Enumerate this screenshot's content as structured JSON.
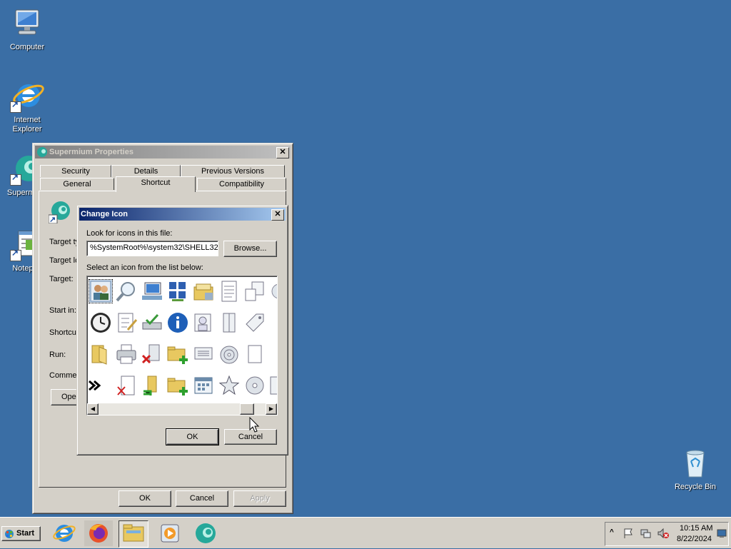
{
  "desktop": {
    "icons": [
      {
        "label": "Computer"
      },
      {
        "label": "Internet Explorer"
      },
      {
        "label": "Supermium"
      },
      {
        "label": "Notepad"
      },
      {
        "label": "Recycle Bin"
      }
    ]
  },
  "properties_dialog": {
    "title": "Supermium Properties",
    "tabs_row1": [
      "Security",
      "Details",
      "Previous Versions"
    ],
    "tabs_row2": [
      "General",
      "Shortcut",
      "Compatibility"
    ],
    "active_tab": "Shortcut",
    "fields": {
      "target_type": "Target ty",
      "target_location": "Target lo",
      "target": "Target:",
      "start_in": "Start in:",
      "shortcut_key": "Shortcut",
      "run": "Run:",
      "comment": "Commen",
      "open_button": "Ope"
    },
    "buttons": {
      "ok": "OK",
      "cancel": "Cancel",
      "apply": "Apply"
    }
  },
  "change_icon_dialog": {
    "title": "Change Icon",
    "look_label": "Look for icons in this file:",
    "file_value": "%SystemRoot%\\system32\\SHELL32",
    "browse_label": "Browse...",
    "select_label": "Select an icon from the list below:",
    "ok_label": "OK",
    "cancel_label": "Cancel",
    "icon_names": [
      "users-icon",
      "magnifier-icon",
      "network-computer-icon",
      "network-grid-icon",
      "folder-stack-icon",
      "document-icon",
      "copy-window-icon",
      "partial-icon",
      "clock-icon",
      "checklist-icon",
      "drive-check-icon",
      "info-icon",
      "user-card-icon",
      "split-panel-icon",
      "tag-icon",
      "open-folder-icon",
      "printer-icon",
      "delete-file-icon",
      "folder-add-icon",
      "list-window-icon",
      "disc-stack-icon",
      "blank-page-icon",
      "arrows-icon",
      "delete-page-icon",
      "folder-check-icon",
      "folder-add-icon",
      "calendar-grid-icon",
      "star-icon",
      "cd-icon",
      "partial-icon"
    ]
  },
  "taskbar": {
    "start_label": "Start",
    "apps": [
      "internet-explorer-icon",
      "firefox-icon",
      "file-explorer-icon",
      "media-player-icon",
      "supermium-icon"
    ],
    "clock_time": "10:15 AM",
    "clock_date": "8/22/2024"
  }
}
